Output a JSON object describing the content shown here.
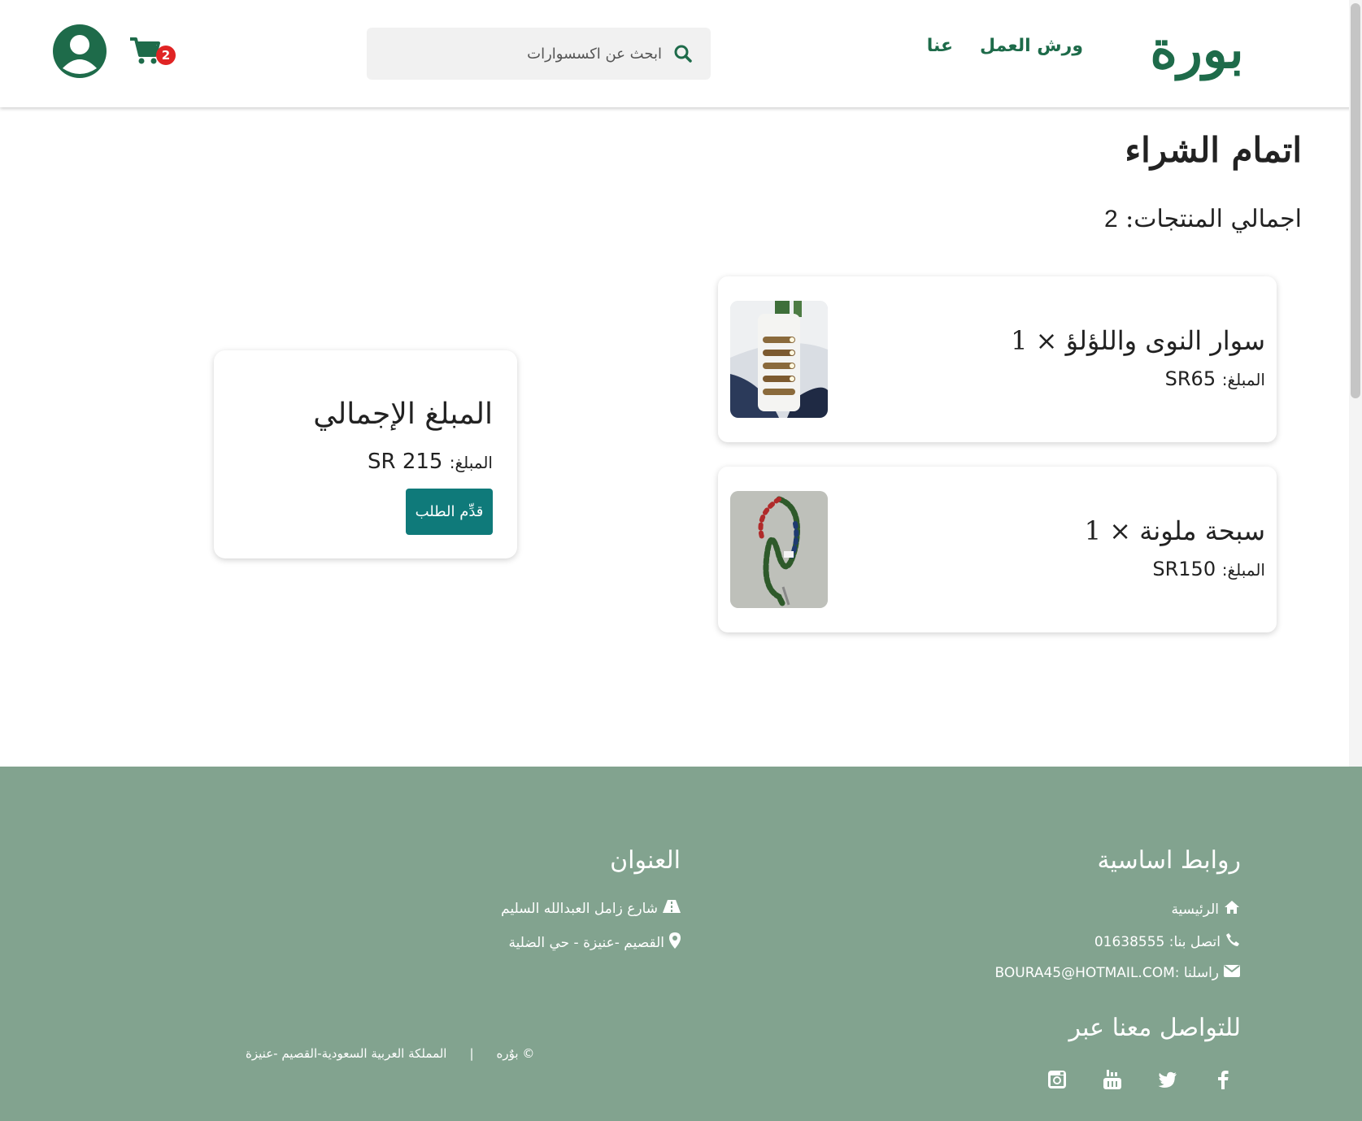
{
  "header": {
    "logo_text": "بورة",
    "nav": {
      "workshops": "ورش العمل",
      "about": "عنا"
    },
    "search": {
      "placeholder": "ابحث عن اكسسوارات"
    },
    "cart": {
      "count": "2"
    },
    "colors": {
      "brand": "#1e6b4a",
      "badge": "#e02424"
    }
  },
  "checkout": {
    "title": "اتمام الشراء",
    "total_products_label": "اجمالي المنتجات:",
    "total_products_value": "2",
    "items": [
      {
        "name": "سوار النوى واللؤلؤ × 1",
        "price_label": "المبلغ:",
        "price_value": "SR65"
      },
      {
        "name": "سبحة ملونة × 1",
        "price_label": "المبلغ:",
        "price_value": "SR150"
      }
    ],
    "summary": {
      "title": "المبلغ الإجمالي",
      "amount_label": "المبلغ:",
      "amount_value": "SR 215",
      "submit_label": "قدِّم الطلب"
    },
    "colors": {
      "submit": "#0f7a7a"
    }
  },
  "footer": {
    "links_title": "روابط اساسية",
    "home": "الرئيسية",
    "phone": "اتصل بنا: 01638555",
    "email": "راسلنا :BOURA45@HOTMAIL.COM",
    "address_title": "العنوان",
    "street": "شارع زامل العبدالله السليم",
    "area": "القصيم -عنيزة - حي الضلية",
    "social_title": "للتواصل معنا عبر",
    "social": [
      "facebook-icon",
      "twitter-icon",
      "youtube-icon",
      "instagram-icon"
    ],
    "copyright_name": "© بوٌره",
    "separator": "|",
    "copyright_location": "المملكة العربية السعودية-القصيم -عنيزة",
    "colors": {
      "background": "#82a38f"
    }
  }
}
